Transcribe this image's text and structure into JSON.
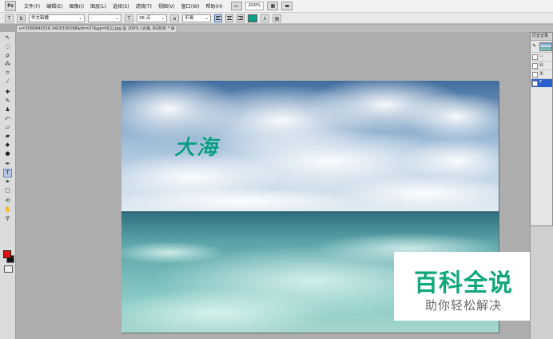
{
  "app": {
    "logo": "Ps"
  },
  "menu": {
    "items": [
      "文件(F)",
      "编辑(E)",
      "图像(I)",
      "图层(L)",
      "选择(S)",
      "滤镜(T)",
      "视图(V)",
      "窗口(W)",
      "帮助(H)"
    ],
    "zoom": "200%"
  },
  "options": {
    "tool_glyph": "T",
    "font_family": "华文新魏",
    "font_style": "-",
    "font_size": "36 点",
    "antialias": "平滑",
    "text_color": "#0f9e86"
  },
  "document": {
    "tab_title": "u=3580840316,3418336298&fm=27&gp=0[1].jpg @ 200% (大海, RGB/8) *"
  },
  "canvas": {
    "text_layer": "大海"
  },
  "colors": {
    "foreground": "#e01010",
    "background": "#111111"
  },
  "history": {
    "title": "历史记录"
  },
  "watermark": {
    "title": "百科全说",
    "subtitle": "助你轻松解决"
  }
}
